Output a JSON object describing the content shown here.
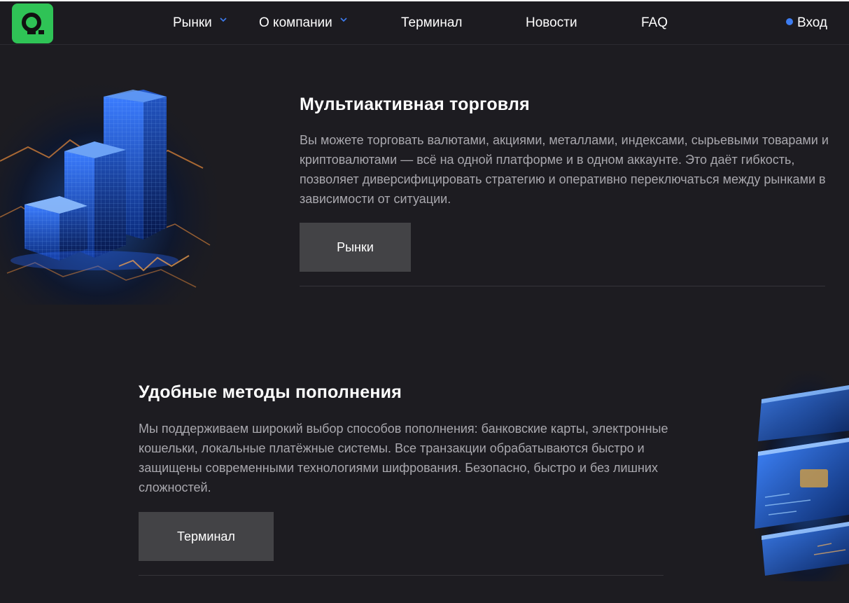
{
  "nav": {
    "items": [
      {
        "label": "Рынки",
        "dropdown": true
      },
      {
        "label": "О компании",
        "dropdown": true
      },
      {
        "label": "Терминал",
        "dropdown": false
      },
      {
        "label": "Новости",
        "dropdown": false
      },
      {
        "label": "FAQ",
        "dropdown": false
      }
    ],
    "login_label": "Вход"
  },
  "sections": [
    {
      "title": "Мультиактивная торговля",
      "text": "Вы можете торговать валютами, акциями, металлами, индексами, сырьевыми товарами и криптовалютами — всё на одной платформе и в одном аккаунте. Это даёт гибкость, позволяет диверсифицировать стратегию и оперативно переключаться между рынками в зависимости от ситуации.",
      "button_label": "Рынки",
      "image_icon": "skyscraper-chart-illustration"
    },
    {
      "title": "Удобные методы пополнения",
      "text": "Мы поддерживаем широкий выбор способов пополнения: банковские карты, электронные кошельки, локальные платёжные системы. Все транзакции обрабатываются быстро и защищены современными технологиями шифрования. Безопасно, быстро и без лишних сложностей.",
      "button_label": "Терминал",
      "image_icon": "payment-cards-illustration"
    }
  ],
  "colors": {
    "background": "#1d1c21",
    "logo_green": "#2fc356",
    "button_gray": "#434346",
    "text_muted": "#a9a8ae",
    "accent_blue": "#3d7cf0"
  }
}
